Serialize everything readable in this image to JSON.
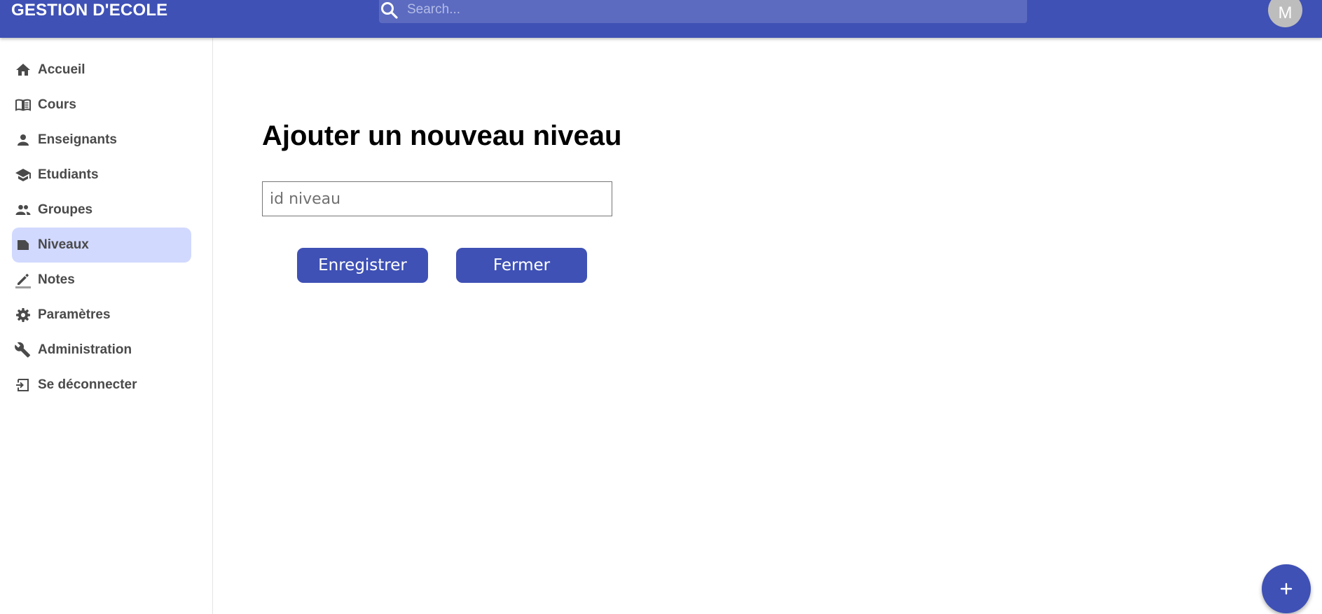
{
  "header": {
    "app_title": "GESTION D'ECOLE",
    "search_placeholder": "Search...",
    "avatar_initial": "M"
  },
  "sidebar": {
    "items": [
      {
        "label": "Accueil",
        "icon": "home-icon",
        "active": false
      },
      {
        "label": "Cours",
        "icon": "book-icon",
        "active": false
      },
      {
        "label": "Enseignants",
        "icon": "person-icon",
        "active": false
      },
      {
        "label": "Etudiants",
        "icon": "school-icon",
        "active": false
      },
      {
        "label": "Groupes",
        "icon": "people-icon",
        "active": false
      },
      {
        "label": "Niveaux",
        "icon": "label-icon",
        "active": true
      },
      {
        "label": "Notes",
        "icon": "edit-icon",
        "active": false
      },
      {
        "label": "Paramètres",
        "icon": "gear-icon",
        "active": false
      },
      {
        "label": "Administration",
        "icon": "wrench-icon",
        "active": false
      },
      {
        "label": "Se déconnecter",
        "icon": "logout-icon",
        "active": false
      }
    ]
  },
  "main": {
    "title": "Ajouter un nouveau niveau",
    "id_field": {
      "placeholder": "id niveau",
      "value": ""
    },
    "save_label": "Enregistrer",
    "close_label": "Fermer"
  },
  "fab": {
    "icon": "plus-icon"
  },
  "colors": {
    "primary": "#3f51b5",
    "search_bg": "#5c6bc0",
    "active_item_bg": "#d1d9ff",
    "avatar_bg": "#bdbdbd",
    "nav_text": "#4a4a4a"
  }
}
